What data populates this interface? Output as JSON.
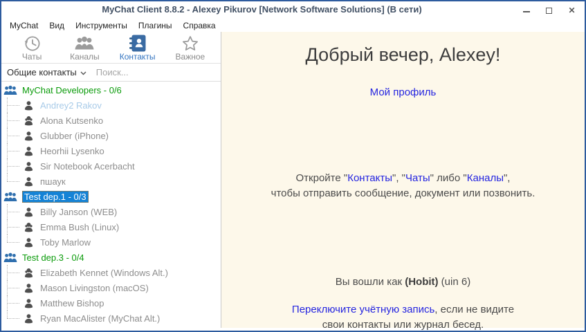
{
  "window": {
    "title": "MyChat Client 8.8.2 - Alexey Pikurov [Network Software Solutions] (В сети)",
    "controls": [
      {
        "name": "minimize-icon"
      },
      {
        "name": "maximize-icon"
      },
      {
        "name": "close-icon"
      }
    ]
  },
  "menu": {
    "items": [
      "MyChat",
      "Вид",
      "Инструменты",
      "Плагины",
      "Справка"
    ]
  },
  "toolbar": {
    "items": [
      {
        "id": "chats",
        "label": "Чаты",
        "icon": "history-clock-icon",
        "active": false
      },
      {
        "id": "channels",
        "label": "Каналы",
        "icon": "people-group-icon",
        "active": false
      },
      {
        "id": "contacts",
        "label": "Контакты",
        "icon": "address-book-icon",
        "active": true
      },
      {
        "id": "important",
        "label": "Важное",
        "icon": "star-icon",
        "active": false
      }
    ]
  },
  "filter": {
    "group_selector_label": "Общие контакты",
    "group_selector_icon": "chevron-down-icon",
    "search_placeholder": "Поиск...",
    "search_value": "",
    "search_icon": "magnifier-icon"
  },
  "contact_tree": {
    "rows": [
      {
        "type": "group",
        "label": "MyChat Developers - 0/6",
        "selected": false
      },
      {
        "type": "contact",
        "name": "Andrey2 Rakov",
        "gender": "male",
        "state": "away",
        "last": false
      },
      {
        "type": "contact",
        "name": "Alona Kutsenko",
        "gender": "female",
        "state": "offline",
        "last": false
      },
      {
        "type": "contact",
        "name": "Glubber (iPhone)",
        "gender": "male",
        "state": "offline",
        "last": false
      },
      {
        "type": "contact",
        "name": "Heorhii Lysenko",
        "gender": "male",
        "state": "offline",
        "last": false
      },
      {
        "type": "contact",
        "name": "Sir Notebook Acerbacht",
        "gender": "male",
        "state": "offline",
        "last": false
      },
      {
        "type": "contact",
        "name": "пшаук",
        "gender": "male",
        "state": "offline",
        "last": true
      },
      {
        "type": "group",
        "label": "Test dep.1 - 0/3",
        "selected": true
      },
      {
        "type": "contact",
        "name": "Billy Janson (WEB)",
        "gender": "male",
        "state": "offline",
        "last": false
      },
      {
        "type": "contact",
        "name": "Emma Bush (Linux)",
        "gender": "female",
        "state": "offline",
        "last": false
      },
      {
        "type": "contact",
        "name": "Toby Marlow",
        "gender": "male",
        "state": "offline",
        "last": true
      },
      {
        "type": "group",
        "label": "Test dep.3 - 0/4",
        "selected": false
      },
      {
        "type": "contact",
        "name": "Elizabeth Kennet (Windows Alt.)",
        "gender": "female",
        "state": "offline",
        "last": false
      },
      {
        "type": "contact",
        "name": "Mason Livingston (macOS)",
        "gender": "male",
        "state": "offline",
        "last": false
      },
      {
        "type": "contact",
        "name": "Matthew Bishop",
        "gender": "male",
        "state": "offline",
        "last": false
      },
      {
        "type": "contact",
        "name": "Ryan MacAlister (MyChat Alt.)",
        "gender": "male",
        "state": "offline",
        "last": true
      }
    ]
  },
  "main": {
    "greeting": "Добрый вечер, Alexey!",
    "profile_link": "Мой профиль",
    "hint": {
      "t1": "Откройте \"",
      "link_contacts": "Контакты",
      "t2": "\", \"",
      "link_chats": "Чаты",
      "t3": "\" либо \"",
      "link_channels": "Каналы",
      "t4": "\",",
      "line2": "чтобы отправить сообщение, документ или позвонить."
    },
    "login": {
      "prefix": "Вы вошли как ",
      "account": "(Hobit)",
      "suffix": " (uin 6)"
    },
    "switch": {
      "link": "Переключите учётную запись",
      "rest": ", если не видите",
      "line2": "свои контакты или журнал бесед."
    }
  },
  "colors": {
    "window_border": "#2d5b9e",
    "right_panel_bg": "#fdf8ea",
    "selection_blue": "#1583d6",
    "group_green": "#0a9b0a",
    "link_blue": "#2525e0",
    "active_tab_blue": "#3374c0",
    "book_icon_blue": "#3a6ba3",
    "contact_name_gray": "#8d8d8d",
    "away_contact_blue": "#a8cbe8"
  }
}
